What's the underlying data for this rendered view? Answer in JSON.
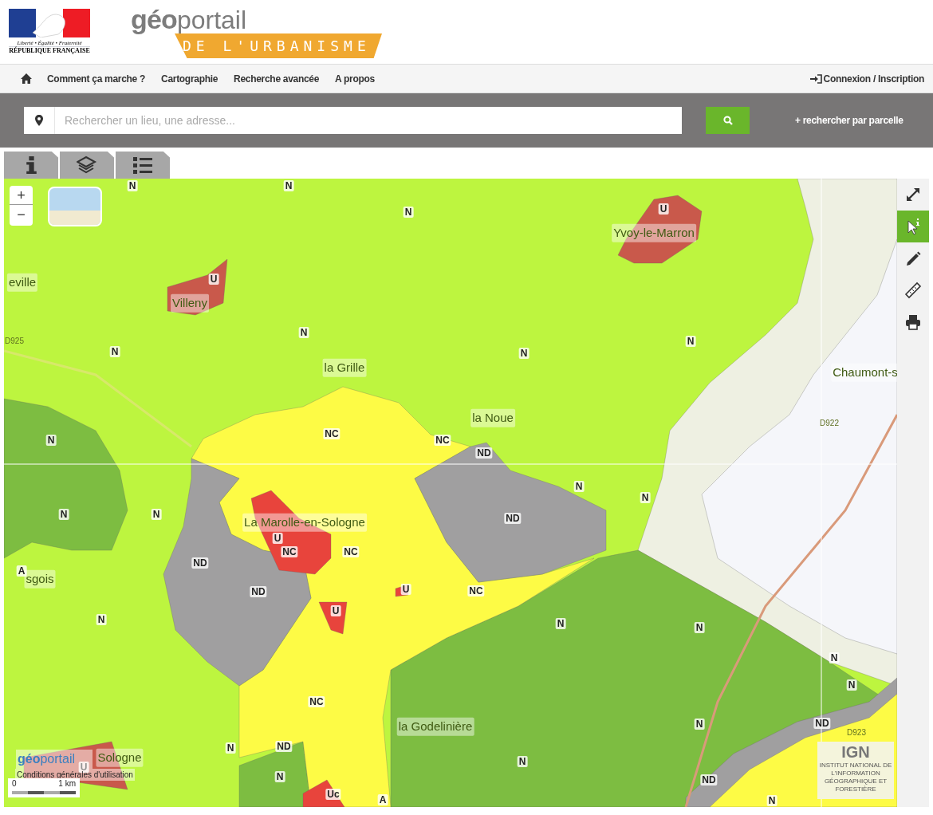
{
  "header": {
    "marianne": {
      "motto": "Liberté • Égalité • Fraternité",
      "name": "RÉPUBLIQUE FRANÇAISE"
    },
    "logo": {
      "part_1": "géo",
      "part_2": "portail",
      "subtitle": "DE L'URBANISME"
    }
  },
  "nav": {
    "items": [
      "Comment ça marche ?",
      "Cartographie",
      "Recherche avancée",
      "A propos"
    ],
    "login": "Connexion / Inscription"
  },
  "search": {
    "placeholder": "Rechercher un lieu, une adresse...",
    "parcel_link": "+ rechercher par parcelle"
  },
  "panel_tabs": [
    {
      "kind": "info"
    },
    {
      "kind": "layers"
    },
    {
      "kind": "list"
    }
  ],
  "map": {
    "zoom": {
      "in": "+",
      "out": "−"
    },
    "place_labels": [
      "eville",
      "Villeny",
      "Yvoy-le-Marron",
      "la Grille",
      "la Noue",
      "Chaumont-s",
      "La Marolle-en-Sologne",
      "sgois",
      "la Godelinière",
      "Sologne",
      "D925",
      "D922",
      "D923"
    ],
    "zone_labels": [
      "N",
      "N",
      "N",
      "U",
      "U",
      "N",
      "N",
      "N",
      "N",
      "N",
      "NC",
      "NC",
      "ND",
      "N",
      "N",
      "N",
      "ND",
      "N",
      "U",
      "NC",
      "NC",
      "ND",
      "ND",
      "U",
      "NC",
      "U",
      "A",
      "N",
      "N",
      "N",
      "N",
      "N",
      "NC",
      "N",
      "ND",
      "N",
      "ND",
      "U",
      "N",
      "N",
      "ND",
      "Uc",
      "A",
      "N"
    ],
    "tools": [
      {
        "kind": "fullscreen",
        "selected": false
      },
      {
        "kind": "info",
        "selected": true
      },
      {
        "kind": "draw",
        "selected": false
      },
      {
        "kind": "measure",
        "selected": false
      },
      {
        "kind": "print",
        "selected": false
      }
    ],
    "attribution": {
      "logo_1": "géo",
      "logo_2": "portail",
      "terms": "Conditions générales d'utilisation"
    },
    "scale": {
      "start": "0",
      "end": "1 km"
    },
    "ign": {
      "acronym": "IGN",
      "name": "INSTITUT NATIONAL DE L'INFORMATION GÉOGRAPHIQUE ET FORESTIÈRE"
    }
  }
}
